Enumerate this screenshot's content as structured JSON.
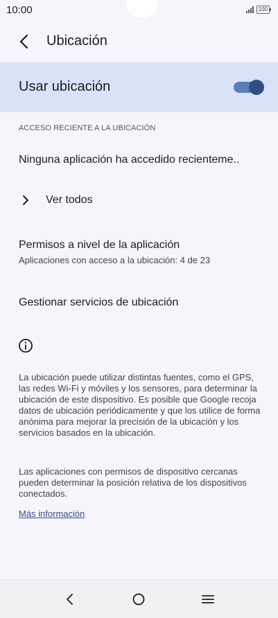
{
  "status_bar": {
    "time": "10:00",
    "battery": "100"
  },
  "header": {
    "title": "Ubicación"
  },
  "master_switch": {
    "label": "Usar ubicación",
    "enabled": true
  },
  "recent_access": {
    "section_title": "ACCESO RECIENTE A LA UBICACIÓN",
    "empty_text": "Ninguna aplicación ha accedido recienteme..",
    "see_all_label": "Ver todos"
  },
  "app_permissions": {
    "title": "Permisos a nivel de la aplicación",
    "summary": "Aplicaciones con acceso a la ubicación: 4 de 23"
  },
  "manage_services": {
    "label": "Gestionar servicios de ubicación"
  },
  "footer_info": {
    "paragraph1": "La ubicación puede utilizar distintas fuentes, como el GPS, las redes Wi-Fi y móviles y los sensores, para determinar la ubicación de este dispositivo. Es posible que Google recoja datos de ubicación periódicamente y que los utilice de forma anónima para mejorar la precisión de la ubicación y los servicios basados en la ubicación.",
    "paragraph2": "Las aplicaciones con permisos de dispositivo cercanas pueden determinar la posición relativa de los dispositivos conectados.",
    "link_label": "Más información"
  },
  "nav": {
    "back_icon": "back-icon",
    "home_icon": "home-icon",
    "recents_icon": "menu-icon"
  },
  "colors": {
    "accent": "#2e4f86",
    "highlight_bg": "#d8e2f8",
    "background": "#f6f5fb"
  }
}
